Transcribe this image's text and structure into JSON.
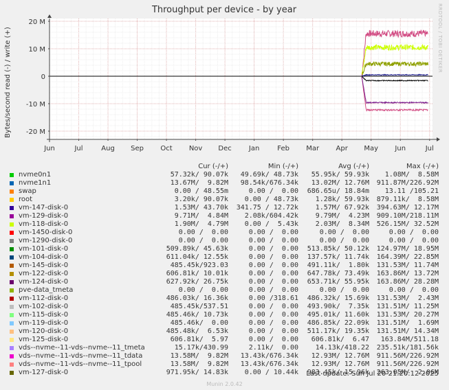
{
  "chart_data": {
    "type": "line",
    "title": "Throughput per device - by year",
    "ylabel": "Bytes/second read (-) / write (+)",
    "ylim": [
      -23,
      21
    ],
    "yticks": [
      {
        "v": 20,
        "label": "20 M"
      },
      {
        "v": 10,
        "label": "10 M"
      },
      {
        "v": 0,
        "label": "0"
      },
      {
        "v": -10,
        "label": "-10 M"
      },
      {
        "v": -20,
        "label": "-20 M"
      }
    ],
    "xlim": [
      0,
      13.1
    ],
    "xticks": [
      {
        "v": 0,
        "label": "Jun"
      },
      {
        "v": 1,
        "label": "Jul"
      },
      {
        "v": 2,
        "label": "Aug"
      },
      {
        "v": 3,
        "label": "Sep"
      },
      {
        "v": 4,
        "label": "Oct"
      },
      {
        "v": 5,
        "label": "Nov"
      },
      {
        "v": 6,
        "label": "Dec"
      },
      {
        "v": 7,
        "label": "Jan"
      },
      {
        "v": 8,
        "label": "Feb"
      },
      {
        "v": 9,
        "label": "Mar"
      },
      {
        "v": 10,
        "label": "Apr"
      },
      {
        "v": 11,
        "label": "May"
      },
      {
        "v": 12,
        "label": "Jun"
      },
      {
        "v": 13,
        "label": "Jul"
      }
    ],
    "grid": true,
    "series": [
      {
        "name": "vds--nvme--11-vds--nvme--11_tdata",
        "color": "#d24d84",
        "sign": 1,
        "base": 15.5,
        "jitter": 2.5
      },
      {
        "name": "nvme1n1",
        "color": "#d24d84",
        "sign": -1,
        "base": 12.3,
        "jitter": 0.6
      },
      {
        "name": "vm-118-disk-0",
        "color": "#ccff00",
        "sign": 1,
        "base": 10.5,
        "jitter": 2.0
      },
      {
        "name": "vm-124-disk-0",
        "color": "#7b1c8c",
        "sign": -1,
        "base": 9.6,
        "jitter": 0.4
      },
      {
        "name": "vm-129-disk-0",
        "color": "#8fa000",
        "sign": 1,
        "base": 4.5,
        "jitter": 1.5
      },
      {
        "name": "vm-122-disk-0",
        "color": "#000000",
        "sign": -1,
        "base": 1.6,
        "jitter": 0.3
      },
      {
        "name": "vm-147-disk-0",
        "color": "#1c1c8c",
        "sign": 1,
        "base": 0.5,
        "jitter": 0.3
      }
    ]
  },
  "legend": {
    "headers": {
      "cur": "Cur (-/+)",
      "min": "Min (-/+)",
      "avg": "Avg (-/+)",
      "max": "Max (-/+)"
    },
    "rows": [
      {
        "name": "nvme0n1",
        "color": "#00cc00",
        "cur": "57.32k/ 90.07k",
        "min": "49.69k/ 48.73k",
        "avg": "55.95k/ 59.93k",
        "max": "1.08M/  8.58M"
      },
      {
        "name": "nvme1n1",
        "color": "#0066b3",
        "cur": "13.67M/  9.82M",
        "min": "98.54k/676.34k",
        "avg": "13.02M/ 12.76M",
        "max": "911.87M/226.92M"
      },
      {
        "name": "swap",
        "color": "#ff8000",
        "cur": "0.00 / 48.55m",
        "min": "0.00 /  0.00",
        "avg": "686.65u/ 18.84m",
        "max": "13.11 /105.21"
      },
      {
        "name": "root",
        "color": "#ffcc00",
        "cur": "3.20k/ 90.07k",
        "min": "0.00 / 48.73k",
        "avg": "1.28k/ 59.93k",
        "max": "879.11k/  8.58M"
      },
      {
        "name": "vm-147-disk-0",
        "color": "#330099",
        "cur": "1.53M/ 43.70k",
        "min": "341.75 / 12.72k",
        "avg": "1.57M/ 67.92k",
        "max": "394.63M/ 12.17M"
      },
      {
        "name": "vm-129-disk-0",
        "color": "#990099",
        "cur": "9.71M/  4.84M",
        "min": "2.08k/604.42k",
        "avg": "9.79M/  4.23M",
        "max": "909.10M/218.11M"
      },
      {
        "name": "vm-118-disk-0",
        "color": "#ccff00",
        "cur": "1.90M/  4.79M",
        "min": "0.00 /  5.43k",
        "avg": "2.03M/  8.34M",
        "max": "526.15M/ 32.52M"
      },
      {
        "name": "vm-1450-disk-0",
        "color": "#ff0000",
        "cur": "0.00 /  0.00",
        "min": "0.00 /  0.00",
        "avg": "0.00 /  0.00",
        "max": "0.00 /  0.00"
      },
      {
        "name": "vm-1290-disk-0",
        "color": "#808080",
        "cur": "0.00 /  0.00",
        "min": "0.00 /  0.00",
        "avg": "0.00 /  0.00",
        "max": "0.00 /  0.00"
      },
      {
        "name": "vm-101-disk-0",
        "color": "#008f00",
        "cur": "509.89k/ 45.63k",
        "min": "0.00 /  0.00",
        "avg": "513.85k/ 50.12k",
        "max": "124.97M/ 18.95M"
      },
      {
        "name": "vm-104-disk-0",
        "color": "#00487d",
        "cur": "611.04k/ 12.55k",
        "min": "0.00 /  0.00",
        "avg": "137.57k/ 11.74k",
        "max": "164.39M/ 22.85M"
      },
      {
        "name": "vm-145-disk-0",
        "color": "#b35a00",
        "cur": "485.45k/923.03",
        "min": "0.00 /  0.00",
        "avg": "491.11k/  1.80k",
        "max": "131.53M/ 11.74M"
      },
      {
        "name": "vm-122-disk-0",
        "color": "#b38f00",
        "cur": "606.81k/ 10.01k",
        "min": "0.00 /  0.00",
        "avg": "647.78k/ 73.49k",
        "max": "163.86M/ 13.72M"
      },
      {
        "name": "vm-124-disk-0",
        "color": "#6b006b",
        "cur": "627.92k/ 26.75k",
        "min": "0.00 /  0.00",
        "avg": "653.71k/ 55.95k",
        "max": "163.86M/ 28.28M"
      },
      {
        "name": "pve-data_tmeta",
        "color": "#8fb300",
        "cur": "0.00 /  0.00",
        "min": "0.00 /  0.00",
        "avg": "0.00 /  0.00",
        "max": "0.00 /  0.00"
      },
      {
        "name": "vm-112-disk-0",
        "color": "#b30000",
        "cur": "486.03k/ 16.36k",
        "min": "0.00 /318.61",
        "avg": "486.32k/ 15.69k",
        "max": "131.53M/  2.43M"
      },
      {
        "name": "vm-102-disk-0",
        "color": "#bebebe",
        "cur": "485.45k/537.51",
        "min": "0.00 /  0.00",
        "avg": "493.90k/  7.35k",
        "max": "131.51M/ 11.25M"
      },
      {
        "name": "vm-115-disk-0",
        "color": "#80ff80",
        "cur": "485.46k/ 10.73k",
        "min": "0.00 /  0.00",
        "avg": "495.01k/ 11.60k",
        "max": "131.53M/ 20.27M"
      },
      {
        "name": "vm-119-disk-0",
        "color": "#80c9ff",
        "cur": "485.46k/  0.00",
        "min": "0.00 /  0.00",
        "avg": "486.85k/ 22.09k",
        "max": "131.51M/  1.69M"
      },
      {
        "name": "vm-120-disk-0",
        "color": "#ffc080",
        "cur": "485.48k/  6.53k",
        "min": "0.00 /  0.00",
        "avg": "511.17k/ 19.35k",
        "max": "131.51M/ 14.34M"
      },
      {
        "name": "vm-125-disk-0",
        "color": "#ffe680",
        "cur": "606.81k/  5.97",
        "min": "0.00 /  0.00",
        "avg": "606.81k/  6.47",
        "max": "163.84M/511.18"
      },
      {
        "name": "vds--nvme--11-vds--nvme--11_tmeta",
        "color": "#aa80ff",
        "cur": "15.17k/430.99",
        "min": "2.11k/  0.00",
        "avg": "14.13k/418.22",
        "max": "235.51k/181.56k"
      },
      {
        "name": "vds--nvme--11-vds--nvme--11_tdata",
        "color": "#ee00cc",
        "cur": "13.58M/  9.82M",
        "min": "13.43k/676.34k",
        "avg": "12.93M/ 12.76M",
        "max": "911.56M/226.92M"
      },
      {
        "name": "vds--nvme--11-vds--nvme--11_tpool",
        "color": "#ff8080",
        "cur": "13.58M/  9.82M",
        "min": "13.43k/676.34k",
        "avg": "12.93M/ 12.76M",
        "max": "911.56M/226.92M"
      },
      {
        "name": "vm-127-disk-0",
        "color": "#666600",
        "cur": "971.95k/ 14.83k",
        "min": "0.00 / 10.44k",
        "avg": "983.45k/ 15.96k",
        "max": "263.05M/  2.06M"
      }
    ]
  },
  "last_update": "Last update: Sun Jul 20 21:20:12 2025",
  "footer": "Munin 2.0.42",
  "side_text": "RRDTOOL / TOBI OETIKER"
}
